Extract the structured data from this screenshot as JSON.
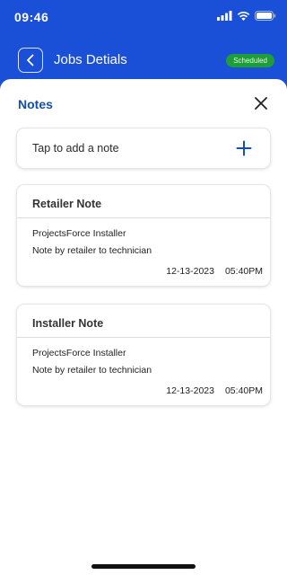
{
  "status_bar": {
    "time": "09:46"
  },
  "header": {
    "title": "Jobs Detials",
    "status_badge": "Scheduled"
  },
  "sheet": {
    "title": "Notes",
    "add_note_placeholder": "Tap to add a note"
  },
  "notes": [
    {
      "title": "Retailer Note",
      "author": "ProjectsForce Installer",
      "body": "Note by retailer to technician",
      "date": "12-13-2023",
      "time": "05:40PM"
    },
    {
      "title": "Installer Note",
      "author": "ProjectsForce Installer",
      "body": "Note by retailer to technician",
      "date": "12-13-2023",
      "time": "05:40PM"
    }
  ],
  "colors": {
    "header_bg": "#1a4fd8",
    "accent": "#1450a3",
    "badge_bg": "#1f9d3a"
  }
}
